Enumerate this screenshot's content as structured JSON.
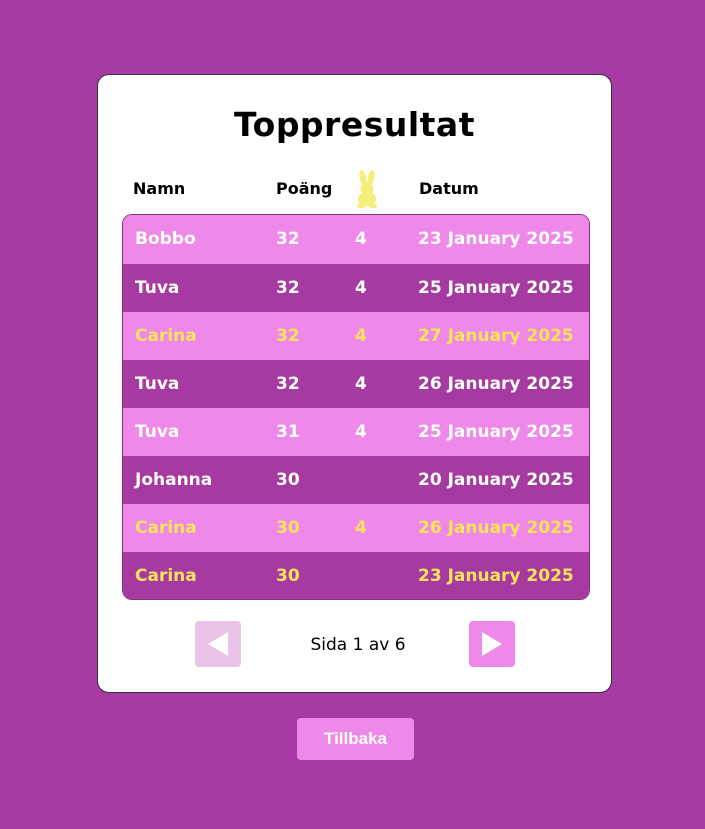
{
  "title": "Toppresultat",
  "headers": {
    "name": "Namn",
    "score": "Poäng",
    "bunny_icon": "bunny-icon",
    "date": "Datum"
  },
  "rows": [
    {
      "name": "Bobbo",
      "score": "32",
      "bunnies": "4",
      "date": "23 January 2025",
      "highlight": false
    },
    {
      "name": "Tuva",
      "score": "32",
      "bunnies": "4",
      "date": "25 January 2025",
      "highlight": false
    },
    {
      "name": "Carina",
      "score": "32",
      "bunnies": "4",
      "date": "27 January 2025",
      "highlight": true
    },
    {
      "name": "Tuva",
      "score": "32",
      "bunnies": "4",
      "date": "26 January 2025",
      "highlight": false
    },
    {
      "name": "Tuva",
      "score": "31",
      "bunnies": "4",
      "date": "25 January 2025",
      "highlight": false
    },
    {
      "name": "Johanna",
      "score": "30",
      "bunnies": "",
      "date": "20 January 2025",
      "highlight": false
    },
    {
      "name": "Carina",
      "score": "30",
      "bunnies": "4",
      "date": "26 January 2025",
      "highlight": true
    },
    {
      "name": "Carina",
      "score": "30",
      "bunnies": "",
      "date": "23 January 2025",
      "highlight": true
    }
  ],
  "pager": {
    "text": "Sida 1 av 6",
    "prev_icon": "play-left-icon",
    "next_icon": "play-right-icon"
  },
  "back_label": "Tillbaka",
  "colors": {
    "background": "#a83ba3",
    "row_light": "#ee88e9",
    "row_dark": "#a63aa1",
    "highlight_text": "#f9e45b",
    "bunny": "#f6ee7a",
    "prev_disabled": "#e9c4e8"
  }
}
